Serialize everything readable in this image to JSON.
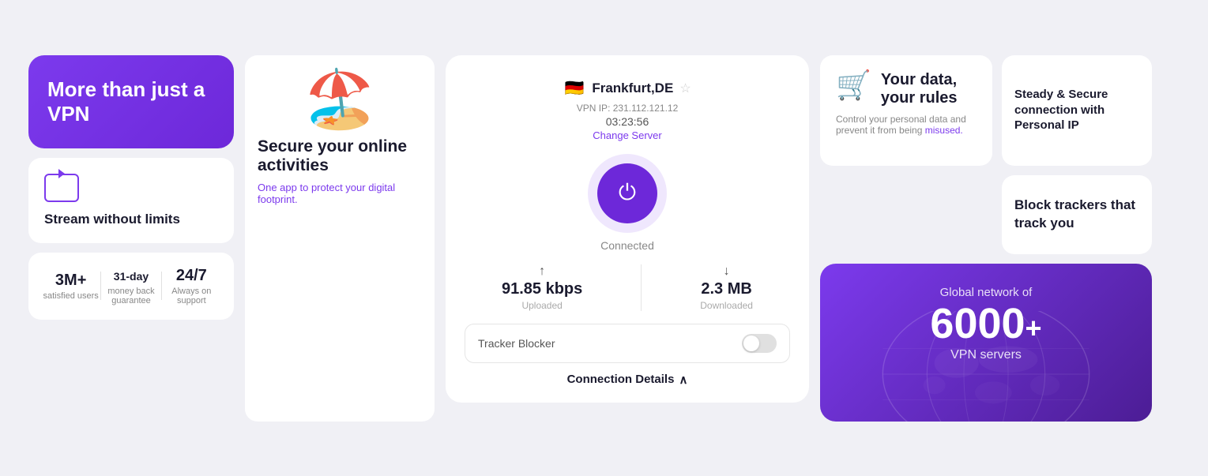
{
  "hero": {
    "title": "More than just a VPN"
  },
  "stream": {
    "title": "Stream without limits"
  },
  "stats": {
    "users_value": "3M+",
    "users_label": "satisfied users",
    "guarantee_value": "31",
    "guarantee_suffix": "-day",
    "guarantee_label": "money back guarantee",
    "support_value": "24/7",
    "support_label": "Always on support"
  },
  "beach": {
    "title": "Secure your online activities",
    "subtitle": "One app to protect your digital footprint."
  },
  "vpn": {
    "server_name": "Frankfurt,DE",
    "vip_ip_label": "VPN IP: 231.112.121.12",
    "timer": "03:23:56",
    "change_server": "Change Server",
    "status": "Connected",
    "upload_value": "91.85 kbps",
    "upload_label": "Uploaded",
    "download_value": "2.3 MB",
    "download_label": "Downloaded",
    "tracker_blocker": "Tracker Blocker",
    "connection_details": "Connection Details"
  },
  "steady": {
    "title": "Steady & Secure connection with Personal IP"
  },
  "your_data": {
    "title": "Your data, your rules",
    "description": "Control your personal data and prevent it from being misused."
  },
  "block_trackers": {
    "title": "Block trackers that track you"
  },
  "global": {
    "label": "Global network of",
    "number": "6000",
    "suffix": "+",
    "servers": "VPN servers"
  }
}
